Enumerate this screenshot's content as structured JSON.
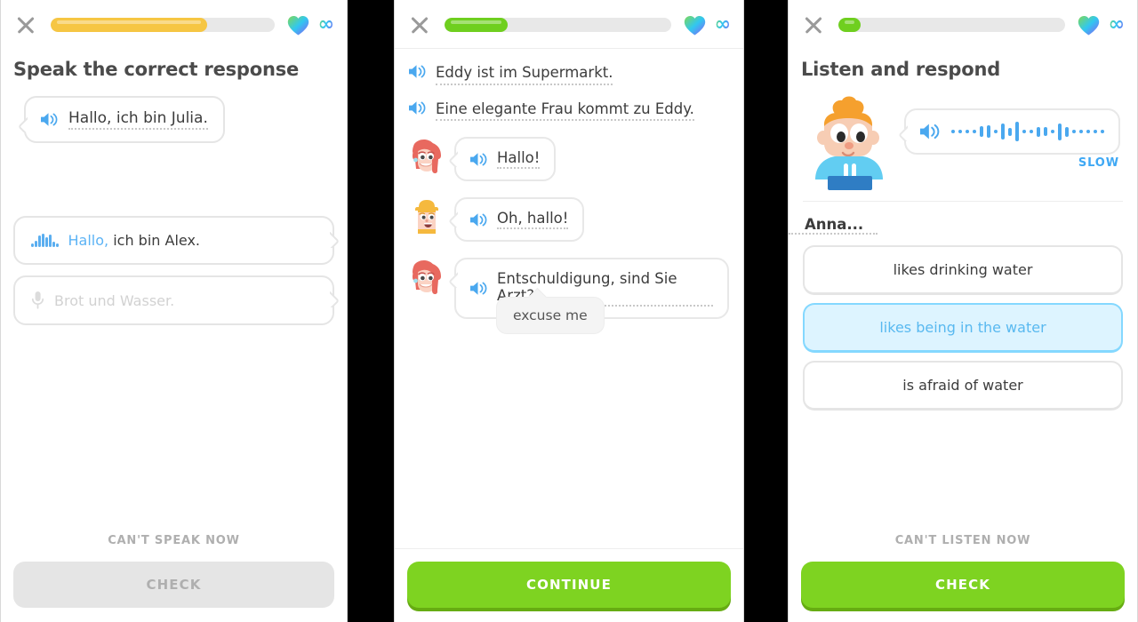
{
  "panels": [
    {
      "header": {
        "close_icon": "close-icon",
        "progress_percent": 70,
        "progress_color": "#f6c643",
        "heart_icon": "heart-icon",
        "infinity_icon": "infinity-icon",
        "infinity_glyph": "∞"
      },
      "title": "Speak the correct response",
      "prompt": {
        "speaker_icon": "speaker-icon",
        "text": "Hallo, ich bin Julia."
      },
      "answers": [
        {
          "icon": "audio-waveform-icon",
          "highlight": "Hallo,",
          "rest": " ich bin Alex."
        },
        {
          "icon": "microphone-icon",
          "placeholder": "Brot und Wasser."
        }
      ],
      "skip_label": "CAN'T SPEAK NOW",
      "action_label": "CHECK",
      "action_state": "disabled"
    },
    {
      "header": {
        "close_icon": "close-icon",
        "progress_percent": 28,
        "progress_color": "#6fcf1f",
        "heart_icon": "heart-icon",
        "infinity_icon": "infinity-icon",
        "infinity_glyph": "∞"
      },
      "narration": [
        {
          "speaker_icon": "speaker-icon",
          "text": "Eddy ist im Supermarkt."
        },
        {
          "speaker_icon": "speaker-icon",
          "text": "Eine elegante Frau kommt zu Eddy."
        }
      ],
      "chat": [
        {
          "avatar": "avatar-julia",
          "speaker_icon": "speaker-icon",
          "text": "Hallo!"
        },
        {
          "avatar": "avatar-eddy",
          "speaker_icon": "speaker-icon",
          "text": "Oh, hallo!"
        },
        {
          "avatar": "avatar-julia",
          "speaker_icon": "speaker-icon",
          "text": "Entschuldigung, sind Sie Arzt?"
        }
      ],
      "tooltip": "excuse me",
      "action_label": "CONTINUE",
      "action_state": "green"
    },
    {
      "header": {
        "close_icon": "close-icon",
        "progress_percent": 10,
        "progress_color": "#6fcf1f",
        "heart_icon": "heart-icon",
        "infinity_icon": "infinity-icon",
        "infinity_glyph": "∞"
      },
      "title": "Listen and respond",
      "character": "duo-character-boy",
      "audio": {
        "speaker_icon": "speaker-icon",
        "waveform_icon": "audio-waveform-icon",
        "slow_label": "SLOW"
      },
      "question_stem": "Anna...",
      "choices": [
        {
          "label": "likes drinking water",
          "selected": false
        },
        {
          "label": "likes being in the water",
          "selected": true
        },
        {
          "label": "is afraid of water",
          "selected": false
        }
      ],
      "skip_label": "CAN'T LISTEN NOW",
      "action_label": "CHECK",
      "action_state": "green"
    }
  ],
  "colors": {
    "accent_blue": "#4aa8ef",
    "green": "#7ed321",
    "yellow": "#f6c643",
    "selected_bg": "#ddf4ff",
    "selected_border": "#84d8ff",
    "text": "#3c3c3c",
    "muted": "#afafaf"
  }
}
